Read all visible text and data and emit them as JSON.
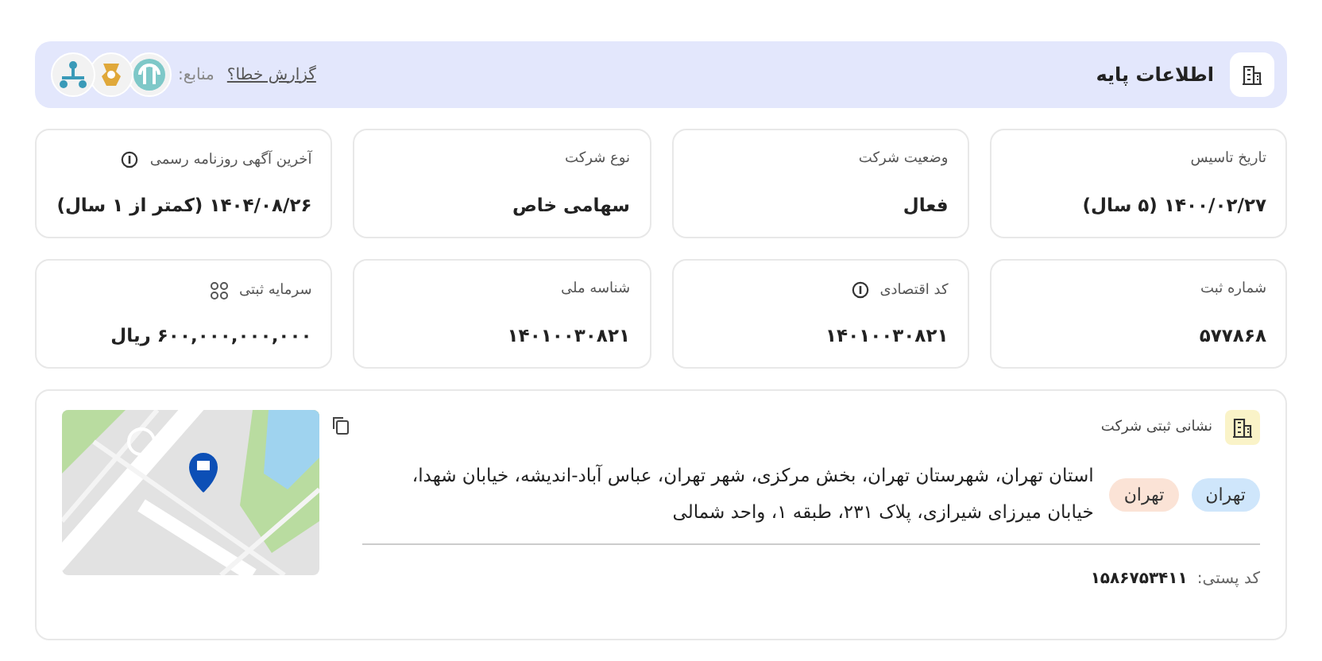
{
  "header": {
    "title": "اطلاعات پایه",
    "report_link": "گزارش خطا؟",
    "sources_label": "منابع:"
  },
  "fields": [
    {
      "label": "تاریخ تاسیس",
      "value": "۱۴۰۰/۰۲/۲۷ (۵ سال)"
    },
    {
      "label": "وضعیت شرکت",
      "value": "فعال"
    },
    {
      "label": "نوع شرکت",
      "value": "سهامی خاص"
    },
    {
      "label": "آخرین آگهی روزنامه رسمی",
      "value": "۱۴۰۴/۰۸/۲۶ (کمتر از ۱ سال)",
      "kind": "info"
    },
    {
      "label": "شماره ثبت",
      "value": "۵۷۷۸۶۸"
    },
    {
      "label": "کد اقتصادی",
      "value": "۱۴۰۱۰۰۳۰۸۲۱",
      "kind": "info"
    },
    {
      "label": "شناسه ملی",
      "value": "۱۴۰۱۰۰۳۰۸۲۱"
    },
    {
      "label": "سرمایه ثبتی",
      "value": "۶۰۰,۰۰۰,۰۰۰,۰۰۰ ریال",
      "kind": "coins"
    }
  ],
  "address": {
    "title": "نشانی ثبتی شرکت",
    "tags": [
      {
        "label": "تهران",
        "color": "#cfe6fb"
      },
      {
        "label": "تهران",
        "color": "#fbe3d6"
      }
    ],
    "text": "استان تهران، شهرستان تهران، بخش مرکزی، شهر تهران، عباس آباد-اندیشه، خیابان شهدا، خیابان میرزای شیرازی، پلاک ۲۳۱، طبقه ۱، واحد شمالی",
    "postal_label": "کد پستی:",
    "postal_code": "۱۵۸۶۷۵۳۴۱۱"
  }
}
